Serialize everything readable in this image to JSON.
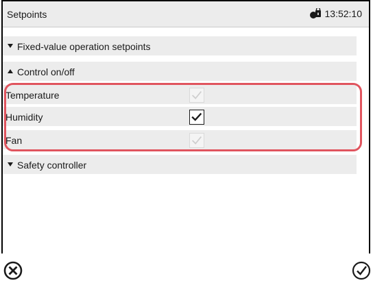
{
  "header": {
    "title": "Setpoints",
    "time": "13:52:10"
  },
  "rows": [
    {
      "type": "section",
      "label": "Fixed-value operation setpoints",
      "expanded": false
    },
    {
      "type": "section",
      "label": "Control on/off",
      "expanded": true
    },
    {
      "type": "item",
      "label": "Temperature",
      "checked": true,
      "enabled": false
    },
    {
      "type": "item",
      "label": "Humidity",
      "checked": true,
      "enabled": true
    },
    {
      "type": "item",
      "label": "Fan",
      "checked": true,
      "enabled": false
    },
    {
      "type": "section",
      "label": "Safety controller",
      "expanded": false
    }
  ],
  "icons": {
    "user": "user-key-icon",
    "cancel": "cancel-icon",
    "confirm": "confirm-check-icon",
    "collapsed": "triangle-down-icon",
    "expanded": "triangle-up-icon"
  },
  "colors": {
    "header_bg": "#ececec",
    "row_bg": "#ececec",
    "highlight": "#e0545e",
    "check_enabled": "#1a1a1a",
    "check_disabled": "#cfcfcf"
  }
}
